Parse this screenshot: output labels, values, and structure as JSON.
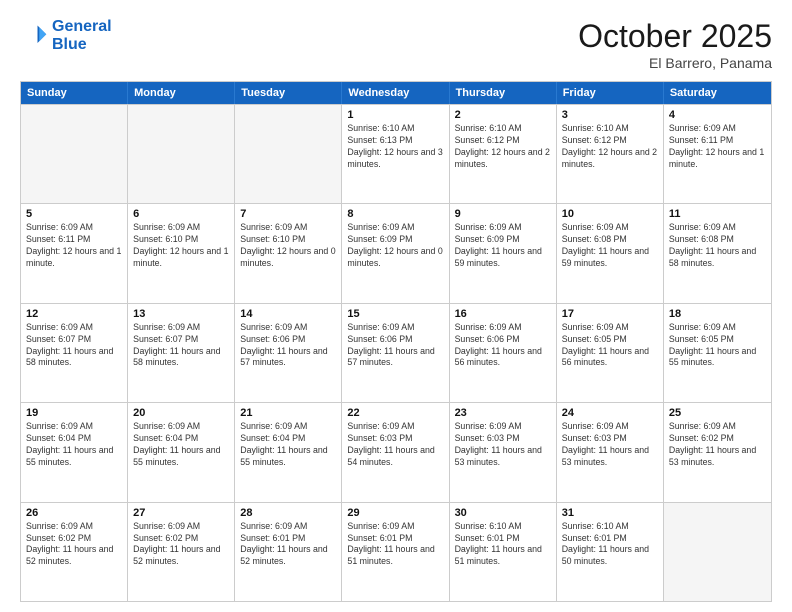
{
  "header": {
    "logo_line1": "General",
    "logo_line2": "Blue",
    "title": "October 2025",
    "subtitle": "El Barrero, Panama"
  },
  "weekdays": [
    "Sunday",
    "Monday",
    "Tuesday",
    "Wednesday",
    "Thursday",
    "Friday",
    "Saturday"
  ],
  "weeks": [
    [
      {
        "day": "",
        "text": ""
      },
      {
        "day": "",
        "text": ""
      },
      {
        "day": "",
        "text": ""
      },
      {
        "day": "1",
        "text": "Sunrise: 6:10 AM\nSunset: 6:13 PM\nDaylight: 12 hours and 3 minutes."
      },
      {
        "day": "2",
        "text": "Sunrise: 6:10 AM\nSunset: 6:12 PM\nDaylight: 12 hours and 2 minutes."
      },
      {
        "day": "3",
        "text": "Sunrise: 6:10 AM\nSunset: 6:12 PM\nDaylight: 12 hours and 2 minutes."
      },
      {
        "day": "4",
        "text": "Sunrise: 6:09 AM\nSunset: 6:11 PM\nDaylight: 12 hours and 1 minute."
      }
    ],
    [
      {
        "day": "5",
        "text": "Sunrise: 6:09 AM\nSunset: 6:11 PM\nDaylight: 12 hours and 1 minute."
      },
      {
        "day": "6",
        "text": "Sunrise: 6:09 AM\nSunset: 6:10 PM\nDaylight: 12 hours and 1 minute."
      },
      {
        "day": "7",
        "text": "Sunrise: 6:09 AM\nSunset: 6:10 PM\nDaylight: 12 hours and 0 minutes."
      },
      {
        "day": "8",
        "text": "Sunrise: 6:09 AM\nSunset: 6:09 PM\nDaylight: 12 hours and 0 minutes."
      },
      {
        "day": "9",
        "text": "Sunrise: 6:09 AM\nSunset: 6:09 PM\nDaylight: 11 hours and 59 minutes."
      },
      {
        "day": "10",
        "text": "Sunrise: 6:09 AM\nSunset: 6:08 PM\nDaylight: 11 hours and 59 minutes."
      },
      {
        "day": "11",
        "text": "Sunrise: 6:09 AM\nSunset: 6:08 PM\nDaylight: 11 hours and 58 minutes."
      }
    ],
    [
      {
        "day": "12",
        "text": "Sunrise: 6:09 AM\nSunset: 6:07 PM\nDaylight: 11 hours and 58 minutes."
      },
      {
        "day": "13",
        "text": "Sunrise: 6:09 AM\nSunset: 6:07 PM\nDaylight: 11 hours and 58 minutes."
      },
      {
        "day": "14",
        "text": "Sunrise: 6:09 AM\nSunset: 6:06 PM\nDaylight: 11 hours and 57 minutes."
      },
      {
        "day": "15",
        "text": "Sunrise: 6:09 AM\nSunset: 6:06 PM\nDaylight: 11 hours and 57 minutes."
      },
      {
        "day": "16",
        "text": "Sunrise: 6:09 AM\nSunset: 6:06 PM\nDaylight: 11 hours and 56 minutes."
      },
      {
        "day": "17",
        "text": "Sunrise: 6:09 AM\nSunset: 6:05 PM\nDaylight: 11 hours and 56 minutes."
      },
      {
        "day": "18",
        "text": "Sunrise: 6:09 AM\nSunset: 6:05 PM\nDaylight: 11 hours and 55 minutes."
      }
    ],
    [
      {
        "day": "19",
        "text": "Sunrise: 6:09 AM\nSunset: 6:04 PM\nDaylight: 11 hours and 55 minutes."
      },
      {
        "day": "20",
        "text": "Sunrise: 6:09 AM\nSunset: 6:04 PM\nDaylight: 11 hours and 55 minutes."
      },
      {
        "day": "21",
        "text": "Sunrise: 6:09 AM\nSunset: 6:04 PM\nDaylight: 11 hours and 55 minutes."
      },
      {
        "day": "22",
        "text": "Sunrise: 6:09 AM\nSunset: 6:03 PM\nDaylight: 11 hours and 54 minutes."
      },
      {
        "day": "23",
        "text": "Sunrise: 6:09 AM\nSunset: 6:03 PM\nDaylight: 11 hours and 53 minutes."
      },
      {
        "day": "24",
        "text": "Sunrise: 6:09 AM\nSunset: 6:03 PM\nDaylight: 11 hours and 53 minutes."
      },
      {
        "day": "25",
        "text": "Sunrise: 6:09 AM\nSunset: 6:02 PM\nDaylight: 11 hours and 53 minutes."
      }
    ],
    [
      {
        "day": "26",
        "text": "Sunrise: 6:09 AM\nSunset: 6:02 PM\nDaylight: 11 hours and 52 minutes."
      },
      {
        "day": "27",
        "text": "Sunrise: 6:09 AM\nSunset: 6:02 PM\nDaylight: 11 hours and 52 minutes."
      },
      {
        "day": "28",
        "text": "Sunrise: 6:09 AM\nSunset: 6:01 PM\nDaylight: 11 hours and 52 minutes."
      },
      {
        "day": "29",
        "text": "Sunrise: 6:09 AM\nSunset: 6:01 PM\nDaylight: 11 hours and 51 minutes."
      },
      {
        "day": "30",
        "text": "Sunrise: 6:10 AM\nSunset: 6:01 PM\nDaylight: 11 hours and 51 minutes."
      },
      {
        "day": "31",
        "text": "Sunrise: 6:10 AM\nSunset: 6:01 PM\nDaylight: 11 hours and 50 minutes."
      },
      {
        "day": "",
        "text": ""
      }
    ]
  ]
}
